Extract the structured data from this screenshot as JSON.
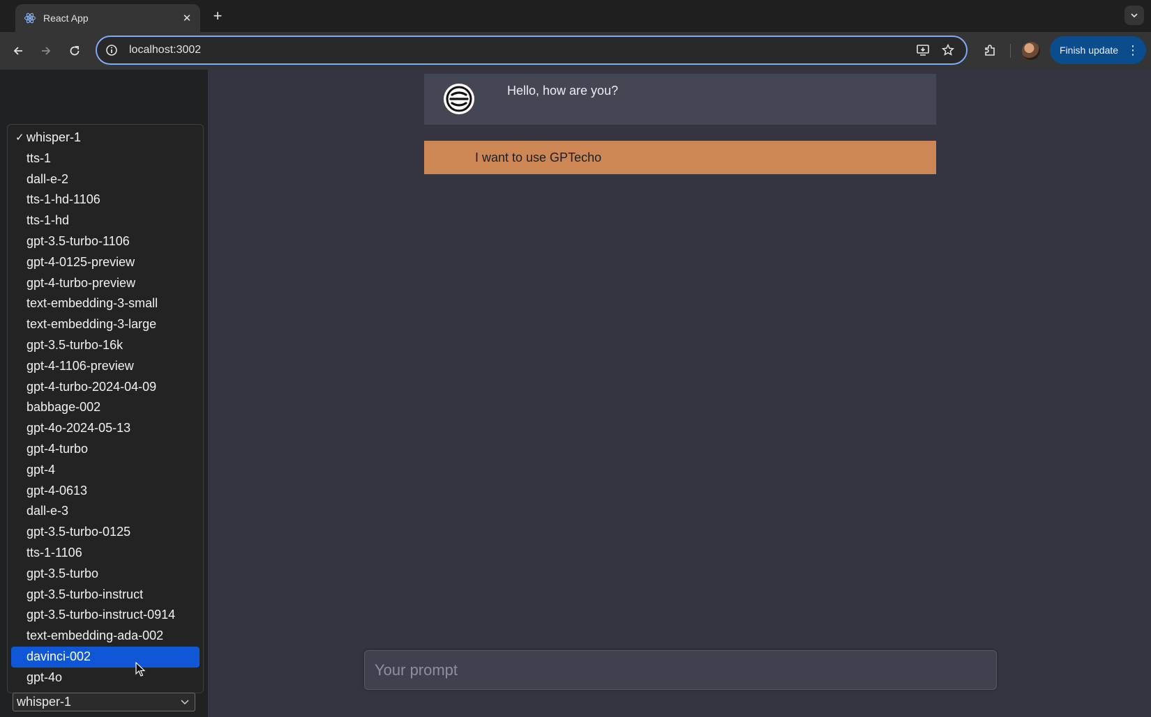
{
  "browser": {
    "tab_title": "React App",
    "url": "localhost:3002",
    "finish_update_label": "Finish update"
  },
  "model_dropdown": {
    "options": [
      "whisper-1",
      "tts-1",
      "dall-e-2",
      "tts-1-hd-1106",
      "tts-1-hd",
      "gpt-3.5-turbo-1106",
      "gpt-4-0125-preview",
      "gpt-4-turbo-preview",
      "text-embedding-3-small",
      "text-embedding-3-large",
      "gpt-3.5-turbo-16k",
      "gpt-4-1106-preview",
      "gpt-4-turbo-2024-04-09",
      "babbage-002",
      "gpt-4o-2024-05-13",
      "gpt-4-turbo",
      "gpt-4",
      "gpt-4-0613",
      "dall-e-3",
      "gpt-3.5-turbo-0125",
      "tts-1-1106",
      "gpt-3.5-turbo",
      "gpt-3.5-turbo-instruct",
      "gpt-3.5-turbo-instruct-0914",
      "text-embedding-ada-002",
      "davinci-002",
      "gpt-4o"
    ],
    "checked": "whisper-1",
    "hovered": "davinci-002",
    "selected_value": "whisper-1"
  },
  "chat": {
    "bot_message": "Hello, how are you?",
    "user_message": "I want to use GPTecho"
  },
  "prompt": {
    "placeholder": "Your prompt",
    "value": ""
  },
  "colors": {
    "main_bg": "#343541",
    "sidebar_bg": "#202123",
    "bot_bubble": "#444654",
    "user_bubble": "#cd8755",
    "highlight": "#0f57d6",
    "update_button": "#0b4c8c"
  }
}
